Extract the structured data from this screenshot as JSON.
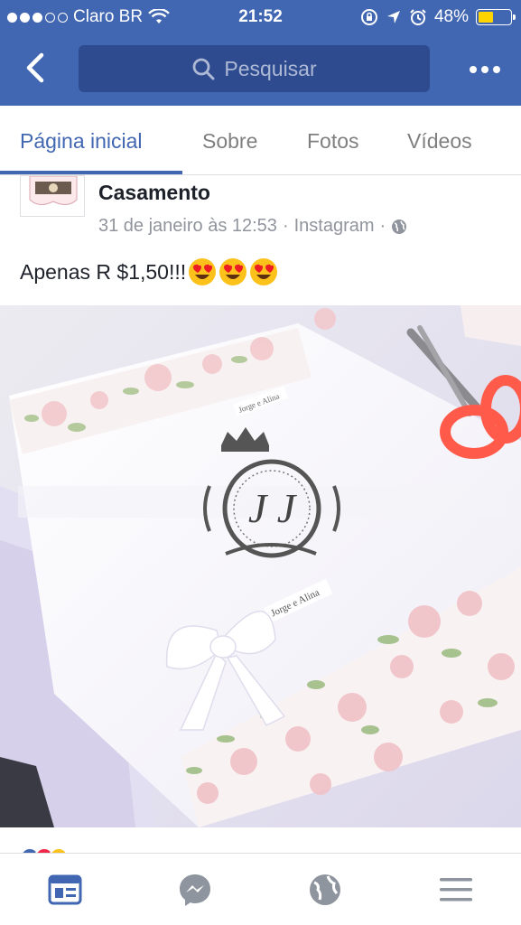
{
  "status_bar": {
    "carrier": "Claro BR",
    "time": "21:52",
    "battery_percent": "48%",
    "battery_level": 0.48,
    "signal_bars_filled": 3,
    "signal_bars_total": 5,
    "icons": [
      "wifi-icon",
      "rotation-lock-icon",
      "location-icon",
      "alarm-icon",
      "battery-icon"
    ]
  },
  "nav": {
    "back_icon": "chevron-left-icon",
    "search_placeholder": "Pesquisar",
    "more_icon": "ellipsis-icon"
  },
  "tabs": [
    {
      "label": "Página inicial",
      "active": true
    },
    {
      "label": "Sobre",
      "active": false
    },
    {
      "label": "Fotos",
      "active": false
    },
    {
      "label": "Vídeos",
      "active": false
    }
  ],
  "post": {
    "page_name": "Casamento",
    "date": "31 de janeiro às 12:53",
    "separator": "·",
    "source": "Instagram",
    "privacy_icon": "globe-icon",
    "text": "Apenas R $1,50!!!",
    "emojis": [
      "heart-eyes-emoji",
      "heart-eyes-emoji",
      "heart-eyes-emoji"
    ],
    "photo": {
      "monogram": "J J",
      "tag_top": "Jorge e Alina",
      "tag_bottom": "Jorge e Alina"
    }
  },
  "bottom_bar": {
    "items": [
      {
        "icon": "news-feed-icon",
        "active": true
      },
      {
        "icon": "messenger-icon",
        "active": false
      },
      {
        "icon": "globe-icon",
        "active": false
      },
      {
        "icon": "menu-icon",
        "active": false
      }
    ]
  },
  "colors": {
    "brand": "#4267b2",
    "search_bg": "#2d4b8e",
    "tab_inactive": "#7f7f7f",
    "meta_text": "#90949c",
    "battery": "#ffd400"
  }
}
